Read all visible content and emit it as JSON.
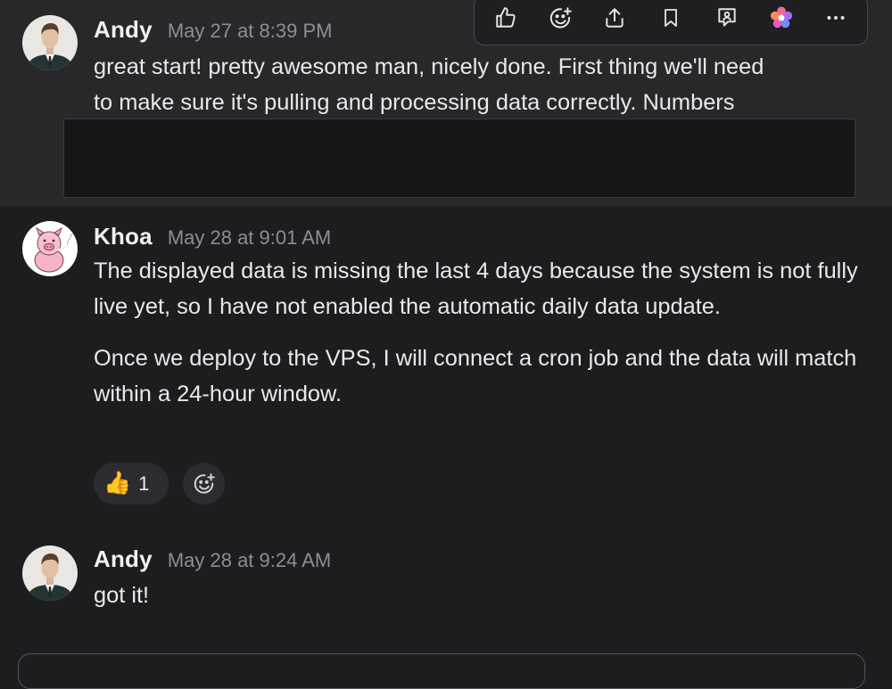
{
  "toolbar": {
    "actions": [
      {
        "icon": "thumbs-up-icon"
      },
      {
        "icon": "add-emoji-icon"
      },
      {
        "icon": "share-icon"
      },
      {
        "icon": "bookmark-icon"
      },
      {
        "icon": "comment-person-icon"
      },
      {
        "icon": "app-flower-icon"
      },
      {
        "icon": "more-icon"
      }
    ]
  },
  "messages": [
    {
      "author": "Andy",
      "timestamp": "May 27 at 8:39 PM",
      "lines": [
        "great start! pretty awesome man, nicely done. First thing we'll need",
        "to make sure it's pulling and processing data correctly. Numbers"
      ]
    },
    {
      "author": "Khoa",
      "timestamp": "May 28 at 9:01 AM",
      "paragraphs": [
        "The displayed data is missing the last 4 days because the system is not fully live yet, so I have not enabled the automatic daily data update.",
        "Once we deploy to the VPS, I will connect a cron job and the data will match within a 24-hour window."
      ],
      "reactions": [
        {
          "emoji": "👍",
          "count": "1"
        }
      ]
    },
    {
      "author": "Andy",
      "timestamp": "May 28 at 9:24 AM",
      "text": "got it!"
    }
  ],
  "colors": {
    "background": "#1d1d20",
    "hover_background": "#28282b",
    "timestamp": "#8d8d93",
    "text": "#e9e9ec"
  }
}
